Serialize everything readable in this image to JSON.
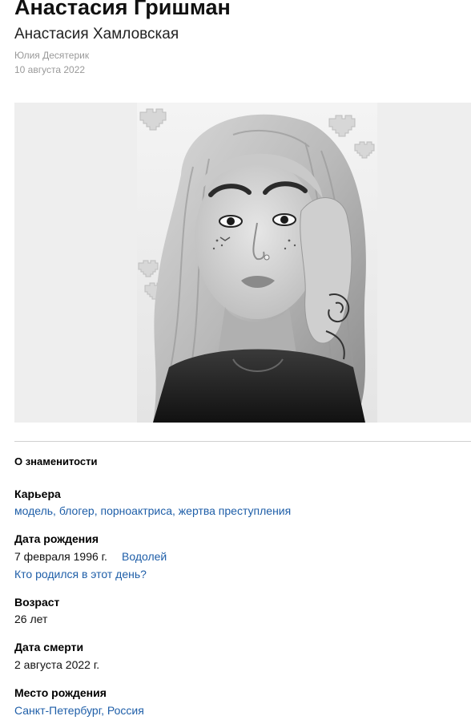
{
  "article": {
    "title": "Анастасия Гришман",
    "subtitle": "Анастасия Хамловская",
    "author": "Юлия Десятерик",
    "date": "10 августа 2022"
  },
  "photo": {
    "subject": "black-and-white portrait photo"
  },
  "celebrity": {
    "section_title": "О знаменитости",
    "career_label": "Карьера",
    "career_value": "модель, блогер, порноактриса, жертва преступления",
    "birth_label": "Дата рождения",
    "birth_date": "7 февраля 1996 г.",
    "zodiac": "Водолей",
    "born_same_day_link": "Кто родился в этот день?",
    "age_label": "Возраст",
    "age_value": "26 лет",
    "death_label": "Дата смерти",
    "death_date": "2 августа 2022 г.",
    "birthplace_label": "Место рождения",
    "birthplace_value": "Санкт-Петербург, Россия"
  }
}
